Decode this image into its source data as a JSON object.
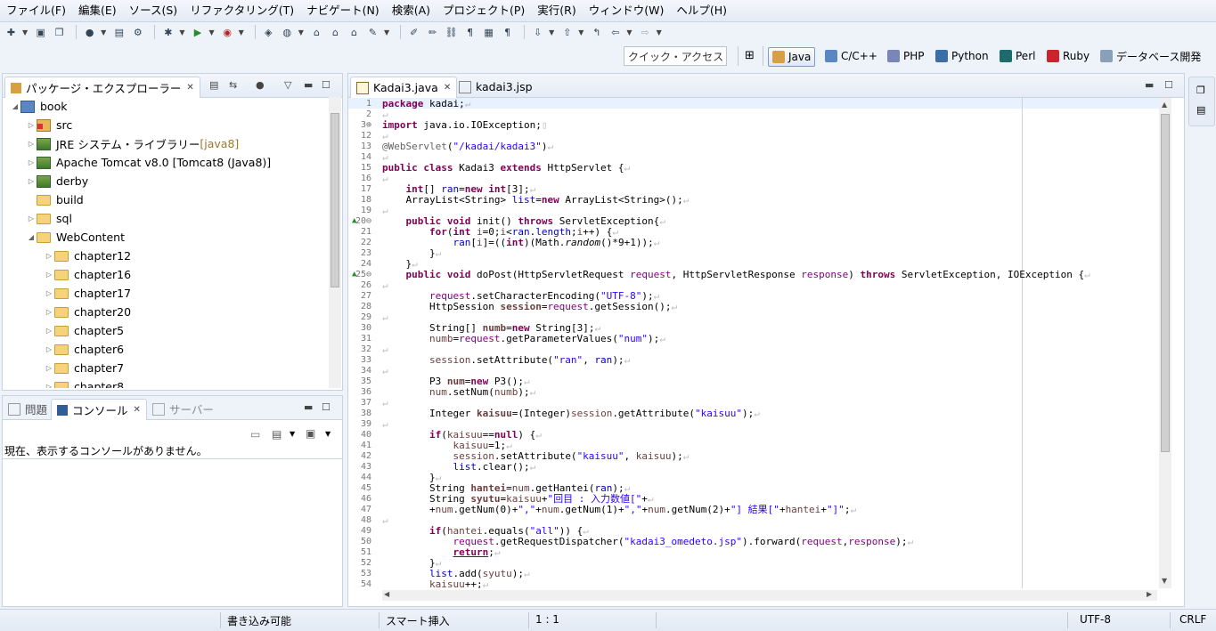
{
  "menu": [
    "ファイル(F)",
    "編集(E)",
    "ソース(S)",
    "リファクタリング(T)",
    "ナビゲート(N)",
    "検索(A)",
    "プロジェクト(P)",
    "実行(R)",
    "ウィンドウ(W)",
    "ヘルプ(H)"
  ],
  "quick_access": "クイック・アクセス",
  "perspectives": {
    "java": "Java",
    "cpp": "C/C++",
    "php": "PHP",
    "python": "Python",
    "perl": "Perl",
    "ruby": "Ruby",
    "db": "データベース開発"
  },
  "explorer": {
    "title": "パッケージ・エクスプローラー",
    "items": [
      {
        "label": "book"
      },
      {
        "label": "src"
      },
      {
        "label": "JRE システム・ライブラリー ",
        "suffix": "[java8]"
      },
      {
        "label": "Apache Tomcat v8.0 [Tomcat8 (Java8)]"
      },
      {
        "label": "derby"
      },
      {
        "label": "build"
      },
      {
        "label": "sql"
      },
      {
        "label": "WebContent"
      },
      {
        "label": "chapter12"
      },
      {
        "label": "chapter16"
      },
      {
        "label": "chapter17"
      },
      {
        "label": "chapter20"
      },
      {
        "label": "chapter5"
      },
      {
        "label": "chapter6"
      },
      {
        "label": "chapter7"
      },
      {
        "label": "chapter8"
      }
    ]
  },
  "bottom_panel": {
    "tab_problems": "問題",
    "tab_console": "コンソール",
    "tab_servers": "サーバー",
    "console_message": "現在、表示するコンソールがありません。"
  },
  "editor": {
    "tab_active": "Kadai3.java",
    "tab_inactive": "kadai3.jsp"
  },
  "status": {
    "writable": "書き込み可能",
    "insert_mode": "スマート挿入",
    "position": "1 : 1",
    "encoding": "UTF-8",
    "line_delim": "CRLF"
  }
}
